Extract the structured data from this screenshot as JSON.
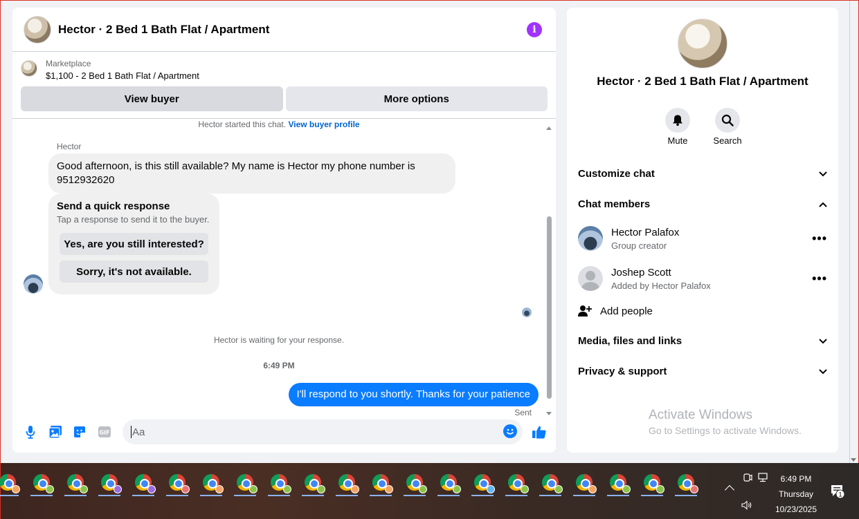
{
  "chat": {
    "title": "Hector · 2 Bed 1 Bath Flat / Apartment",
    "marketplace_label": "Marketplace",
    "listing": "$1,100 - 2 Bed 1 Bath Flat / Apartment",
    "view_buyer": "View buyer",
    "more_options": "More options",
    "started_text": "Hector started this chat.",
    "buyer_profile_link": "View buyer profile",
    "sender_name": "Hector",
    "incoming_message": "Good afternoon, is this still available? My name is Hector my phone number is 9512932620",
    "quick_title": "Send a quick response",
    "quick_sub": "Tap a response to send it to the buyer.",
    "quick_replies": [
      "Yes, are you still interested?",
      "Sorry, it's not available."
    ],
    "waiting_text": "Hector is waiting for your response.",
    "timestamp": "6:49 PM",
    "outgoing_message": "I'll respond to you shortly. Thanks for your patience",
    "sent_label": "Sent",
    "input_placeholder": "Aa"
  },
  "details": {
    "title": "Hector · 2 Bed 1 Bath Flat / Apartment",
    "mute": "Mute",
    "search": "Search",
    "customize_chat": "Customize chat",
    "chat_members": "Chat members",
    "members": [
      {
        "name": "Hector Palafox",
        "sub": "Group creator"
      },
      {
        "name": "Joshep Scott",
        "sub": "Added by Hector Palafox"
      }
    ],
    "add_people": "Add people",
    "media": "Media, files and links",
    "privacy": "Privacy & support",
    "activate_title": "Activate Windows",
    "activate_sub": "Go to Settings to activate Windows."
  },
  "taskbar": {
    "time": "6:49 PM",
    "day": "Thursday",
    "date": "10/23/2025",
    "notification_count": "1",
    "app_icon": "chrome-icon",
    "profile_colors": [
      "#f4a261",
      "#8bc34a",
      "#8bc34a",
      "#9c6ade",
      "#9c6ade",
      "#e57373",
      "#f4a261",
      "#8bc34a",
      "#8bc34a",
      "#8bc34a",
      "#f4a261",
      "#f4a261",
      "#8bc34a",
      "#8bc34a",
      "#64b5f6",
      "#8bc34a",
      "#8bc34a",
      "#f4a261",
      "#8bc34a",
      "#8bc34a",
      "#e57373"
    ]
  },
  "colors": {
    "accent": "#0a7cff",
    "info": "#a033ff"
  }
}
